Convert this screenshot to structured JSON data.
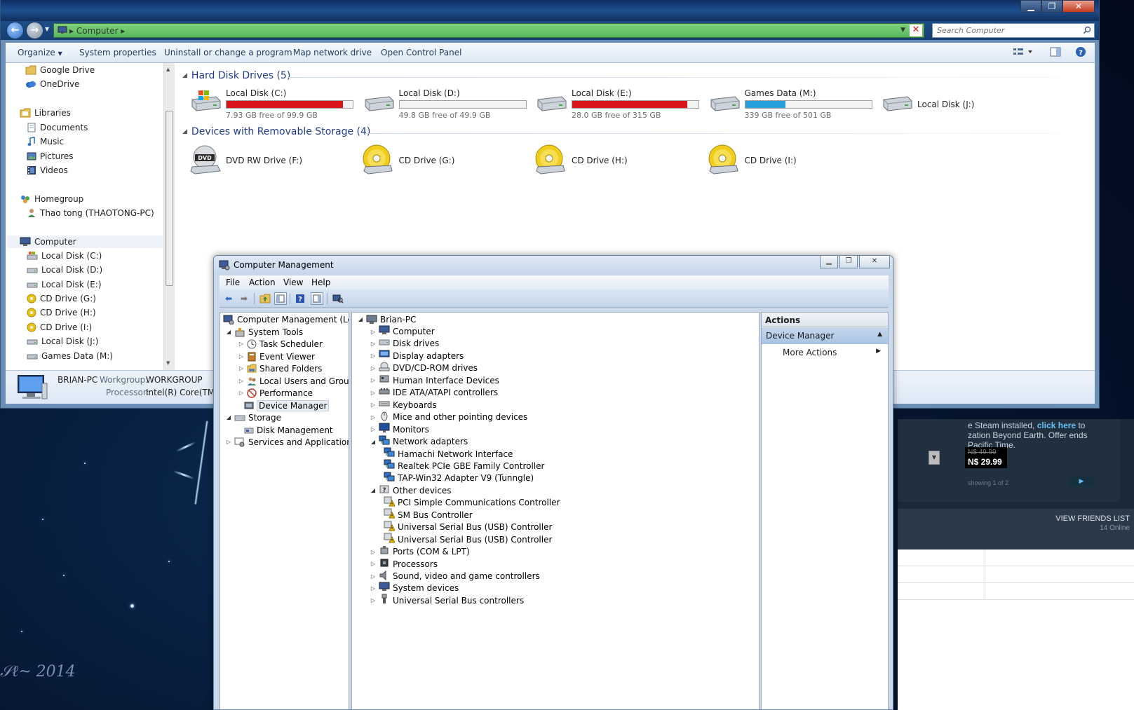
{
  "explorer": {
    "address": "Computer",
    "search_placeholder": "Search Computer",
    "toolbar": {
      "organize": "Organize",
      "system_properties": "System properties",
      "uninstall": "Uninstall or change a program",
      "map_drive": "Map network drive",
      "control_panel": "Open Control Panel"
    },
    "nav": {
      "google_drive": "Google Drive",
      "onedrive": "OneDrive",
      "libraries": "Libraries",
      "documents": "Documents",
      "music": "Music",
      "pictures": "Pictures",
      "videos": "Videos",
      "homegroup": "Homegroup",
      "homegroup_user": "Thao tong (THAOTONG-PC)",
      "computer": "Computer",
      "drives": [
        "Local Disk (C:)",
        "Local Disk (D:)",
        "Local Disk (E:)",
        "CD Drive (G:)",
        "CD Drive (H:)",
        "CD Drive (I:)",
        "Local Disk (J:)",
        "Games Data (M:)"
      ]
    },
    "groups": {
      "hdd_title": "Hard Disk Drives (5)",
      "removable_title": "Devices with Removable Storage (4)"
    },
    "hdd": [
      {
        "name": "Local Disk (C:)",
        "free": "7.93 GB free of 99.9 GB",
        "used_fraction": 0.92,
        "color": "#d9161c"
      },
      {
        "name": "Local Disk (D:)",
        "free": "49.8 GB free of 49.9 GB",
        "used_fraction": 0.0,
        "color": "#26a0da"
      },
      {
        "name": "Local Disk (E:)",
        "free": "28.0 GB free of 315 GB",
        "used_fraction": 0.91,
        "color": "#d9161c"
      },
      {
        "name": "Games Data (M:)",
        "free": "339 GB free of 501 GB",
        "used_fraction": 0.32,
        "color": "#26a0da"
      },
      {
        "name": "Local Disk (J:)"
      }
    ],
    "removable": [
      {
        "name": "DVD RW Drive (F:)",
        "type": "dvd"
      },
      {
        "name": "CD Drive (G:)",
        "type": "cd"
      },
      {
        "name": "CD Drive (H:)",
        "type": "cd"
      },
      {
        "name": "CD Drive (I:)",
        "type": "cd"
      }
    ],
    "details": {
      "name": "BRIAN-PC",
      "workgroup_label": "Workgroup:",
      "workgroup": "WORKGROUP",
      "processor_label": "Processor:",
      "processor": "Intel(R) Core(TM) i7"
    }
  },
  "cm": {
    "title": "Computer Management",
    "menu": {
      "file": "File",
      "action": "Action",
      "view": "View",
      "help": "Help"
    },
    "tree": {
      "root": "Computer Management (Local",
      "system_tools": "System Tools",
      "task_scheduler": "Task Scheduler",
      "event_viewer": "Event Viewer",
      "shared_folders": "Shared Folders",
      "local_users": "Local Users and Groups",
      "performance": "Performance",
      "device_manager": "Device Manager",
      "storage": "Storage",
      "disk_management": "Disk Management",
      "services": "Services and Applications"
    },
    "devices": {
      "root": "Brian-PC",
      "items": [
        {
          "label": "Computer",
          "level": 1,
          "state": "closed",
          "icon": "computer"
        },
        {
          "label": "Disk drives",
          "level": 1,
          "state": "closed",
          "icon": "disk"
        },
        {
          "label": "Display adapters",
          "level": 1,
          "state": "closed",
          "icon": "display"
        },
        {
          "label": "DVD/CD-ROM drives",
          "level": 1,
          "state": "closed",
          "icon": "dvd"
        },
        {
          "label": "Human Interface Devices",
          "level": 1,
          "state": "closed",
          "icon": "hid"
        },
        {
          "label": "IDE ATA/ATAPI controllers",
          "level": 1,
          "state": "closed",
          "icon": "ide"
        },
        {
          "label": "Keyboards",
          "level": 1,
          "state": "closed",
          "icon": "keyboard"
        },
        {
          "label": "Mice and other pointing devices",
          "level": 1,
          "state": "closed",
          "icon": "mouse"
        },
        {
          "label": "Monitors",
          "level": 1,
          "state": "closed",
          "icon": "monitor"
        },
        {
          "label": "Network adapters",
          "level": 1,
          "state": "open",
          "icon": "network"
        },
        {
          "label": "Hamachi Network Interface",
          "level": 2,
          "state": "none",
          "icon": "network"
        },
        {
          "label": "Realtek PCIe GBE Family Controller",
          "level": 2,
          "state": "none",
          "icon": "network"
        },
        {
          "label": "TAP-Win32 Adapter V9 (Tunngle)",
          "level": 2,
          "state": "none",
          "icon": "network"
        },
        {
          "label": "Other devices",
          "level": 1,
          "state": "open",
          "icon": "other"
        },
        {
          "label": "PCI Simple Communications Controller",
          "level": 2,
          "state": "none",
          "icon": "warning"
        },
        {
          "label": "SM Bus Controller",
          "level": 2,
          "state": "none",
          "icon": "warning"
        },
        {
          "label": "Universal Serial Bus (USB) Controller",
          "level": 2,
          "state": "none",
          "icon": "warning"
        },
        {
          "label": "Universal Serial Bus (USB) Controller",
          "level": 2,
          "state": "none",
          "icon": "warning"
        },
        {
          "label": "Ports (COM & LPT)",
          "level": 1,
          "state": "closed",
          "icon": "port"
        },
        {
          "label": "Processors",
          "level": 1,
          "state": "closed",
          "icon": "cpu"
        },
        {
          "label": "Sound, video and game controllers",
          "level": 1,
          "state": "closed",
          "icon": "sound"
        },
        {
          "label": "System devices",
          "level": 1,
          "state": "closed",
          "icon": "system"
        },
        {
          "label": "Universal Serial Bus controllers",
          "level": 1,
          "state": "closed",
          "icon": "usb"
        }
      ]
    },
    "actions": {
      "header": "Actions",
      "section": "Device Manager",
      "more": "More Actions"
    }
  },
  "steam": {
    "offer_line1": "e Steam installed,",
    "offer_link": "click here",
    "offer_line1_end": "to",
    "offer_line2": "zation Beyond Earth. Offer ends",
    "offer_line3": "Pacific Time.",
    "price_old": "N$ 49.99",
    "price_new": "N$ 29.99",
    "showing": "showing 1 of 2",
    "friends_link": "VIEW FRIENDS LIST",
    "friends_count": "14 Online"
  }
}
